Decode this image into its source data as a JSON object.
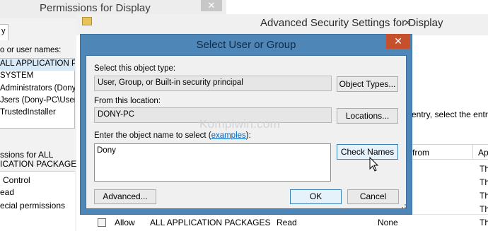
{
  "permissions_window": {
    "title": "Permissions for Display",
    "close_glyph": "✕",
    "tab_label": "y",
    "group_label": "o or user names:",
    "principals": [
      "ALL APPLICATION PA",
      "SYSTEM",
      "Administrators (Dony-PC",
      "Jsers (Dony-PC\\Users)",
      "TrustedInstaller"
    ],
    "perm_header_line1": "ssions for ALL",
    "perm_header_line2": "ICATION PACKAGES",
    "perm_rows": [
      "Control",
      "ead",
      "ecial permissions"
    ]
  },
  "advanced_window": {
    "title": "Advanced Security Settings for Display",
    "close_glyph": "✕",
    "hint_text": "entry, select the entr",
    "grid_headers": {
      "from": "from",
      "applies": "Ap"
    },
    "row_applies": [
      "Th",
      "Th",
      "Th",
      "Th"
    ],
    "bottom_row": {
      "type": "Allow",
      "principal": "ALL APPLICATION PACKAGES",
      "access": "Read",
      "inherited": "None",
      "applies": "Th"
    }
  },
  "dialog": {
    "title": "Select User or Group",
    "close_glyph": "✕",
    "object_type_label": "Select this object type:",
    "object_type_value": "User, Group, or Built-in security principal",
    "object_types_button": "Object Types...",
    "location_label": "From this location:",
    "location_value": "DONY-PC",
    "locations_button": "Locations...",
    "enter_label_prefix": "Enter the object name to select (",
    "enter_label_link": "examples",
    "enter_label_suffix": "):",
    "object_name_value": "Dony",
    "check_names_button": "Check Names",
    "advanced_button": "Advanced...",
    "ok_button": "OK",
    "cancel_button": "Cancel"
  },
  "watermark": "Kompiwin.com"
}
